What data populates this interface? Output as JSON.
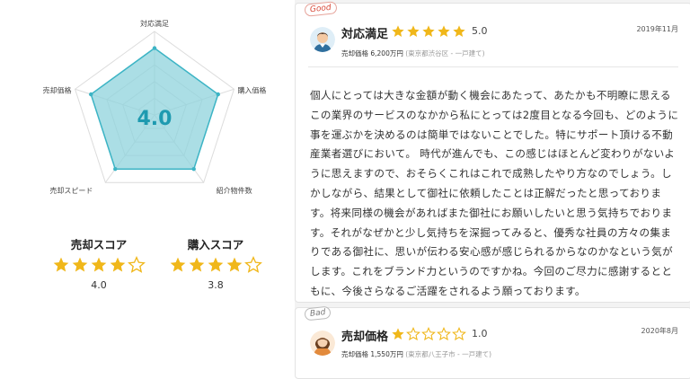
{
  "radar": {
    "center_score": "4.0",
    "axes": [
      "対応満足",
      "購入価格",
      "紹介物件数",
      "売却スピード",
      "売却価格"
    ],
    "values": [
      4,
      4,
      4,
      4,
      4
    ],
    "max": 5,
    "fill_color": "#8fd3dc",
    "stroke_color": "#3cb4c5"
  },
  "scores": [
    {
      "label": "売却スコア",
      "value": "4.0",
      "rating": 4
    },
    {
      "label": "購入スコア",
      "value": "3.8",
      "rating": 4
    }
  ],
  "reviews": [
    {
      "tag": "Good",
      "title": "対応満足",
      "rating": 5,
      "score": "5.0",
      "date": "2019年11月",
      "price": "売却価格 6,200万円",
      "location": "(東京都渋谷区 - 一戸建て)",
      "body": "個人にとっては大きな金額が動く機会にあたって、あたかも不明瞭に思えるこの業界のサービスのなかから私にとっては2度目となる今回も、どのように事を運ぶかを決めるのは簡単ではないことでした。特にサポート頂ける不動産業者選びにおいて。 時代が進んでも、この感じはほとんど変わりがないように思えますので、おそらくこれはこれで成熟したやり方なのでしょう。しかしながら、結果として御社に依頼したことは正解だったと思っております。将来同様の機会があればまた御社にお願いしたいと思う気持ちでおります。それがなぜかと少し気持ちを深掘ってみると、優秀な社員の方々の集まりである御社に、思いが伝わる安心感が感じられるからなのかなという気がします。これをブランド力というのですかね。今回のご尽力に感謝するとともに、今後さらなるご活躍をされるよう願っております。"
    },
    {
      "tag": "Bad",
      "title": "売却価格",
      "rating": 1,
      "score": "1.0",
      "date": "2020年8月",
      "price": "売却価格 1,550万円",
      "location": "(東京都八王子市 - 一戸建て)"
    }
  ],
  "colors": {
    "star": "#f0b71a",
    "star_empty": "#c9c9c9"
  }
}
